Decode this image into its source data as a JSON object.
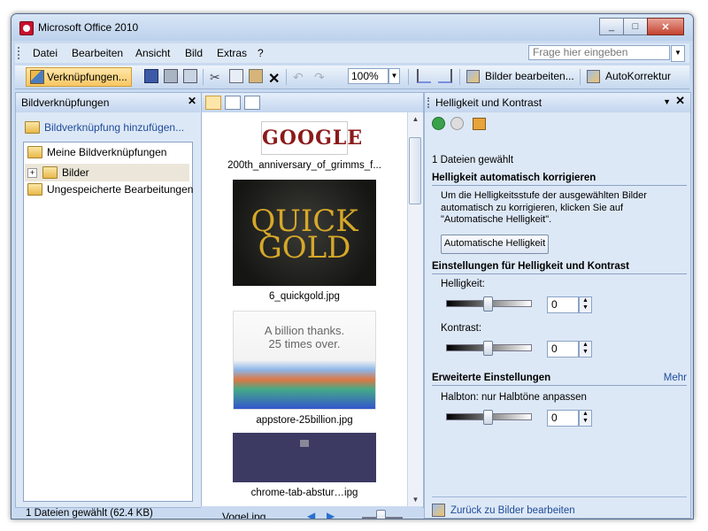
{
  "window": {
    "title": "Microsoft Office 2010",
    "min": "_",
    "max": "□",
    "close": "✕"
  },
  "menu": {
    "items": [
      "Datei",
      "Bearbeiten",
      "Ansicht",
      "Bild",
      "Extras",
      "?"
    ],
    "ask_placeholder": "Frage hier eingeben"
  },
  "toolbar": {
    "links_label": "Verknüpfungen...",
    "zoom": "100%",
    "edit_pictures_label": "Bilder bearbeiten...",
    "autocorrect_label": "AutoKorrektur"
  },
  "left_panel": {
    "title": "Bildverknüpfungen",
    "add_link": "Bildverknüpfung hinzufügen...",
    "tree": [
      "Meine Bildverknüpfungen",
      "Bilder",
      "Ungespeicherte Bearbeitungen"
    ],
    "status": "1 Dateien gewählt (62.4 KB)"
  },
  "thumbnails": [
    {
      "caption": "200th_anniversary_of_grimms_f...",
      "text": "GOOGLE"
    },
    {
      "caption": "6_quickgold.jpg",
      "line1": "QUICK",
      "line2": "GOLD"
    },
    {
      "caption": "appstore-25billion.jpg",
      "line1": "A billion thanks.",
      "line2": "25 times over."
    },
    {
      "caption": "chrome-tab-abstur…ipg"
    }
  ],
  "mid_status": {
    "filename": "Vogel.jpg"
  },
  "right_panel": {
    "title": "Helligkeit und Kontrast",
    "selected": "1 Dateien gewählt",
    "auto_section": "Helligkeit automatisch korrigieren",
    "auto_desc": "Um die Helligkeitsstufe der ausgewählten Bilder automatisch zu korrigieren, klicken Sie auf \"Automatische Helligkeit\".",
    "auto_button": "Automatische Helligkeit",
    "settings_section": "Einstellungen für Helligkeit und Kontrast",
    "brightness_label": "Helligkeit:",
    "brightness_value": "0",
    "contrast_label": "Kontrast:",
    "contrast_value": "0",
    "advanced_section": "Erweiterte Einstellungen",
    "more_link": "Mehr",
    "halftone_label": "Halbton: nur Halbtöne anpassen",
    "halftone_value": "0",
    "back_link": "Zurück zu Bilder bearbeiten"
  }
}
